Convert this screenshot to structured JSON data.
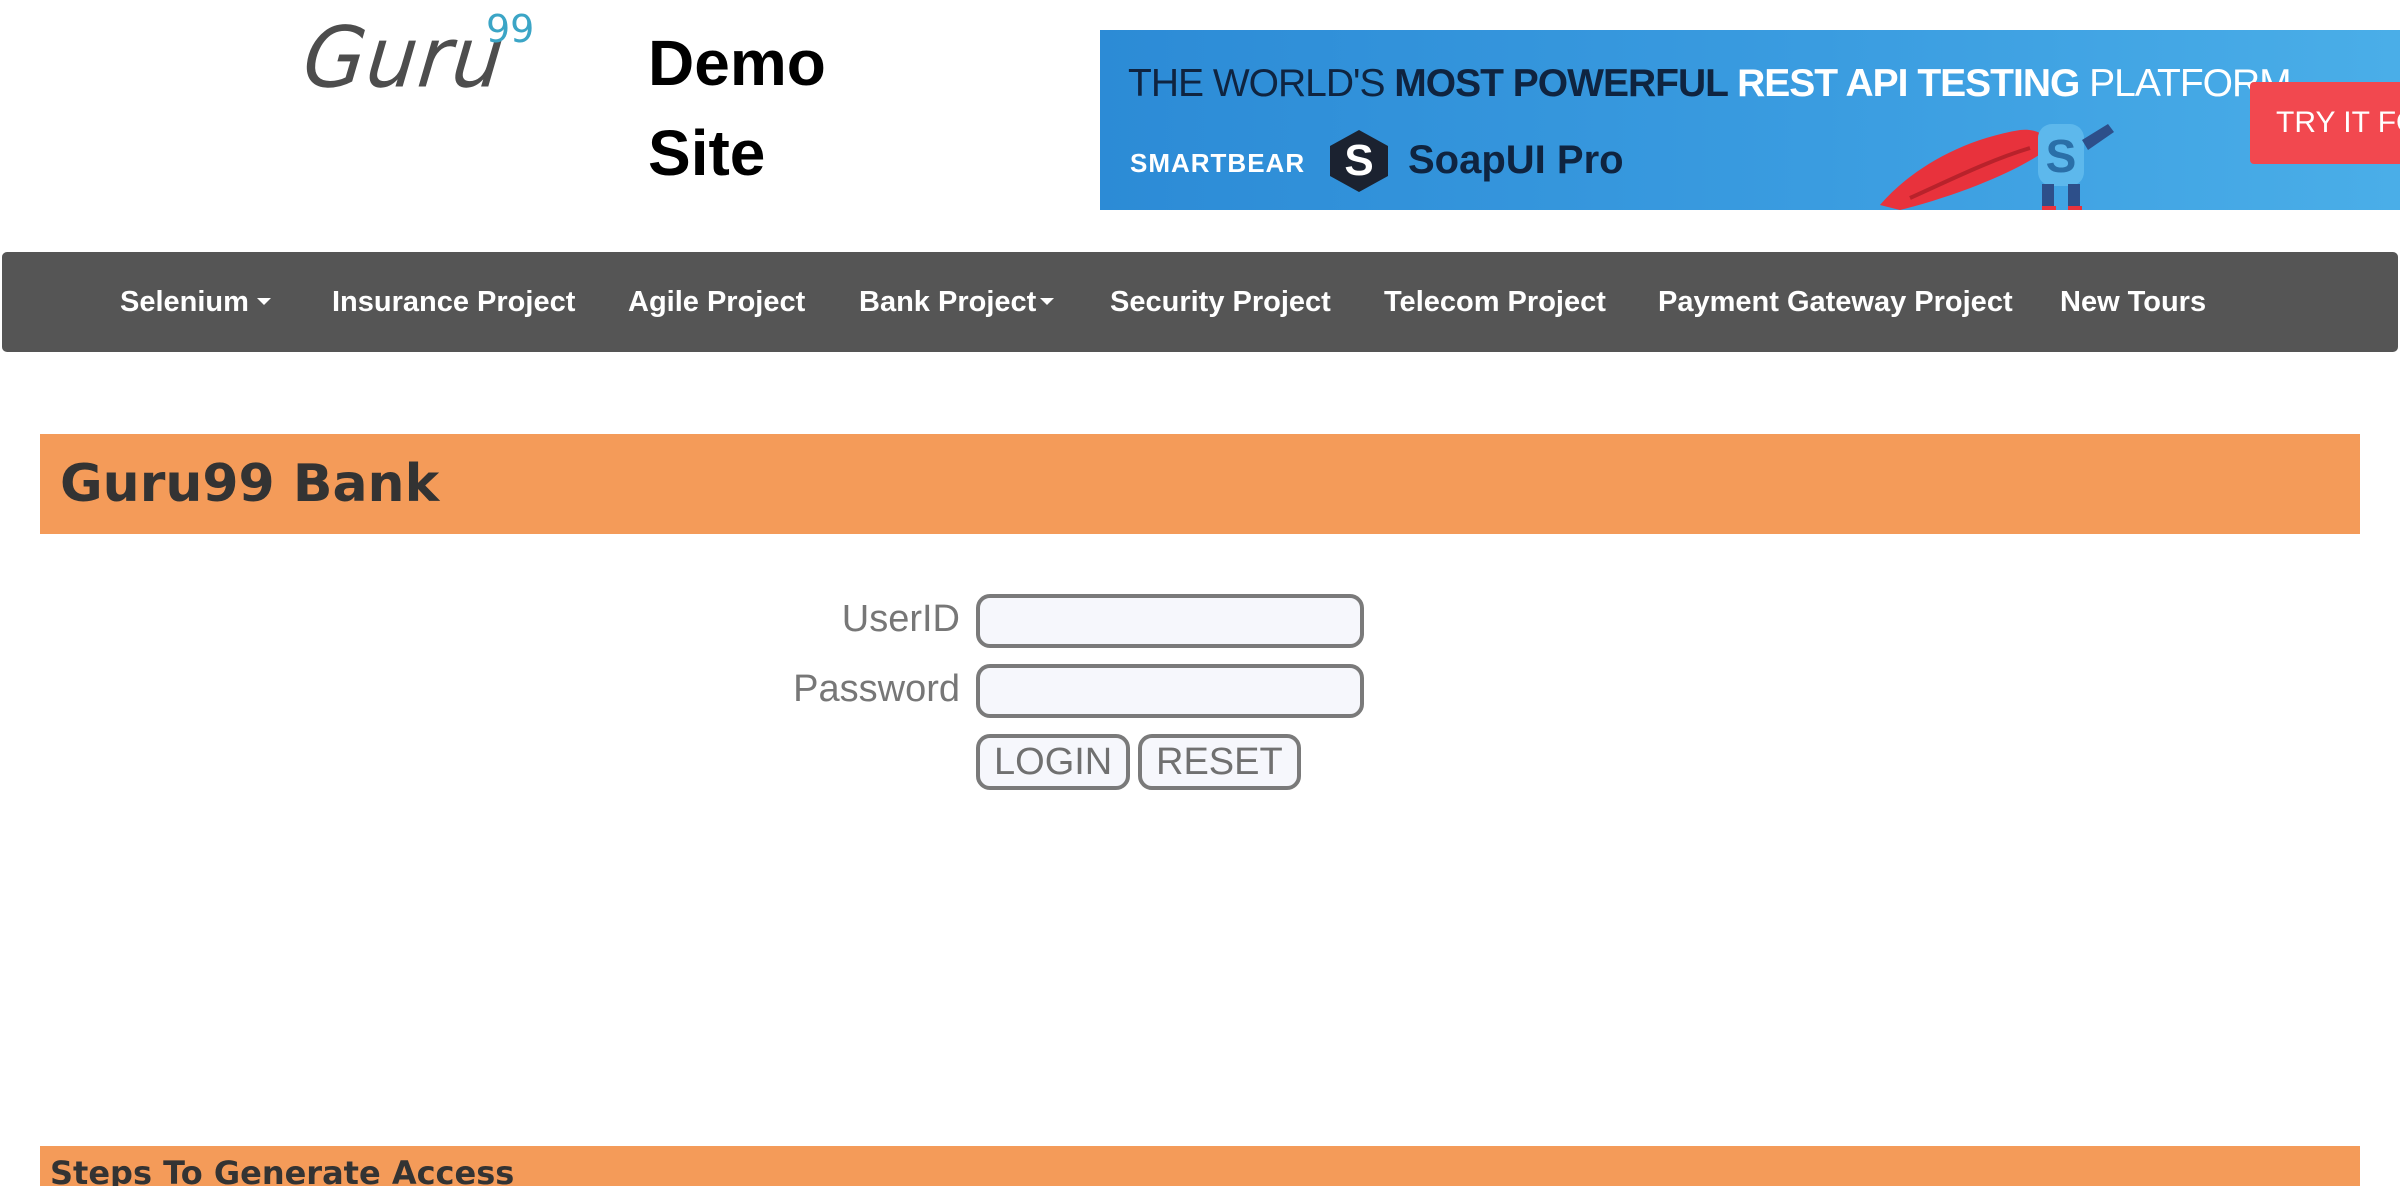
{
  "header": {
    "logo_word": "Guru",
    "logo_superscript": "99",
    "site_title_line1": "Demo",
    "site_title_line2": "Site"
  },
  "ad": {
    "headline_part1": "THE WORLD'S ",
    "headline_part2": "MOST POWERFUL ",
    "headline_part3": "REST API TESTING ",
    "headline_part4": "PLATFORM",
    "brand": "SMARTBEAR",
    "product": "SoapUI Pro",
    "cta": "TRY IT FO",
    "colors": {
      "background": "#3a9ce0",
      "cta": "#f2484f"
    }
  },
  "nav": {
    "items": [
      {
        "label": "Selenium",
        "dropdown": true
      },
      {
        "label": "Insurance Project",
        "dropdown": false
      },
      {
        "label": "Agile Project",
        "dropdown": false
      },
      {
        "label": "Bank Project",
        "dropdown": true
      },
      {
        "label": "Security Project",
        "dropdown": false
      },
      {
        "label": "Telecom Project",
        "dropdown": false
      },
      {
        "label": "Payment Gateway Project",
        "dropdown": false
      },
      {
        "label": "New Tours",
        "dropdown": false
      }
    ],
    "background_color": "#555555"
  },
  "bank": {
    "title": "Guru99 Bank",
    "accent_color": "#f49b59"
  },
  "login_form": {
    "userid_label": "UserID",
    "userid_value": "",
    "password_label": "Password",
    "password_value": "",
    "login_button": "LOGIN",
    "reset_button": "RESET"
  },
  "steps": {
    "title": "Steps To Generate Access"
  }
}
